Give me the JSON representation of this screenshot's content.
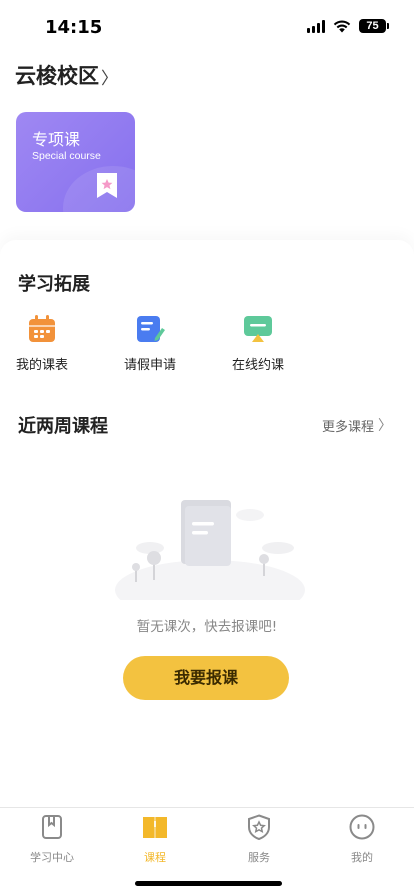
{
  "status": {
    "time": "14:15",
    "battery": "75"
  },
  "header": {
    "campus": "云梭校区",
    "chevron": "〉"
  },
  "special_course": {
    "title_cn": "专项课",
    "title_en": "Special course",
    "icon": "bookmark-star-icon"
  },
  "learning_ext": {
    "title": "学习拓展",
    "items": [
      {
        "label": "我的课表",
        "icon": "calendar-icon",
        "color": "#f2923a"
      },
      {
        "label": "请假申请",
        "icon": "document-edit-icon",
        "color": "#4a7cf0"
      },
      {
        "label": "在线约课",
        "icon": "monitor-icon",
        "color": "#5ec99a"
      }
    ]
  },
  "recent": {
    "title": "近两周课程",
    "more_label": "更多课程",
    "more_chevron": "〉",
    "empty_text": "暂无课次，快去报课吧!",
    "enroll_label": "我要报课"
  },
  "tabbar": {
    "items": [
      {
        "label": "学习中心",
        "icon": "study-center-icon",
        "active": false
      },
      {
        "label": "课程",
        "icon": "course-book-icon",
        "active": true
      },
      {
        "label": "服务",
        "icon": "service-shield-icon",
        "active": false
      },
      {
        "label": "我的",
        "icon": "profile-face-icon",
        "active": false
      }
    ]
  },
  "colors": {
    "accent": "#f3c240",
    "card": "#8e78f0",
    "tab_active": "#f3b82a"
  }
}
